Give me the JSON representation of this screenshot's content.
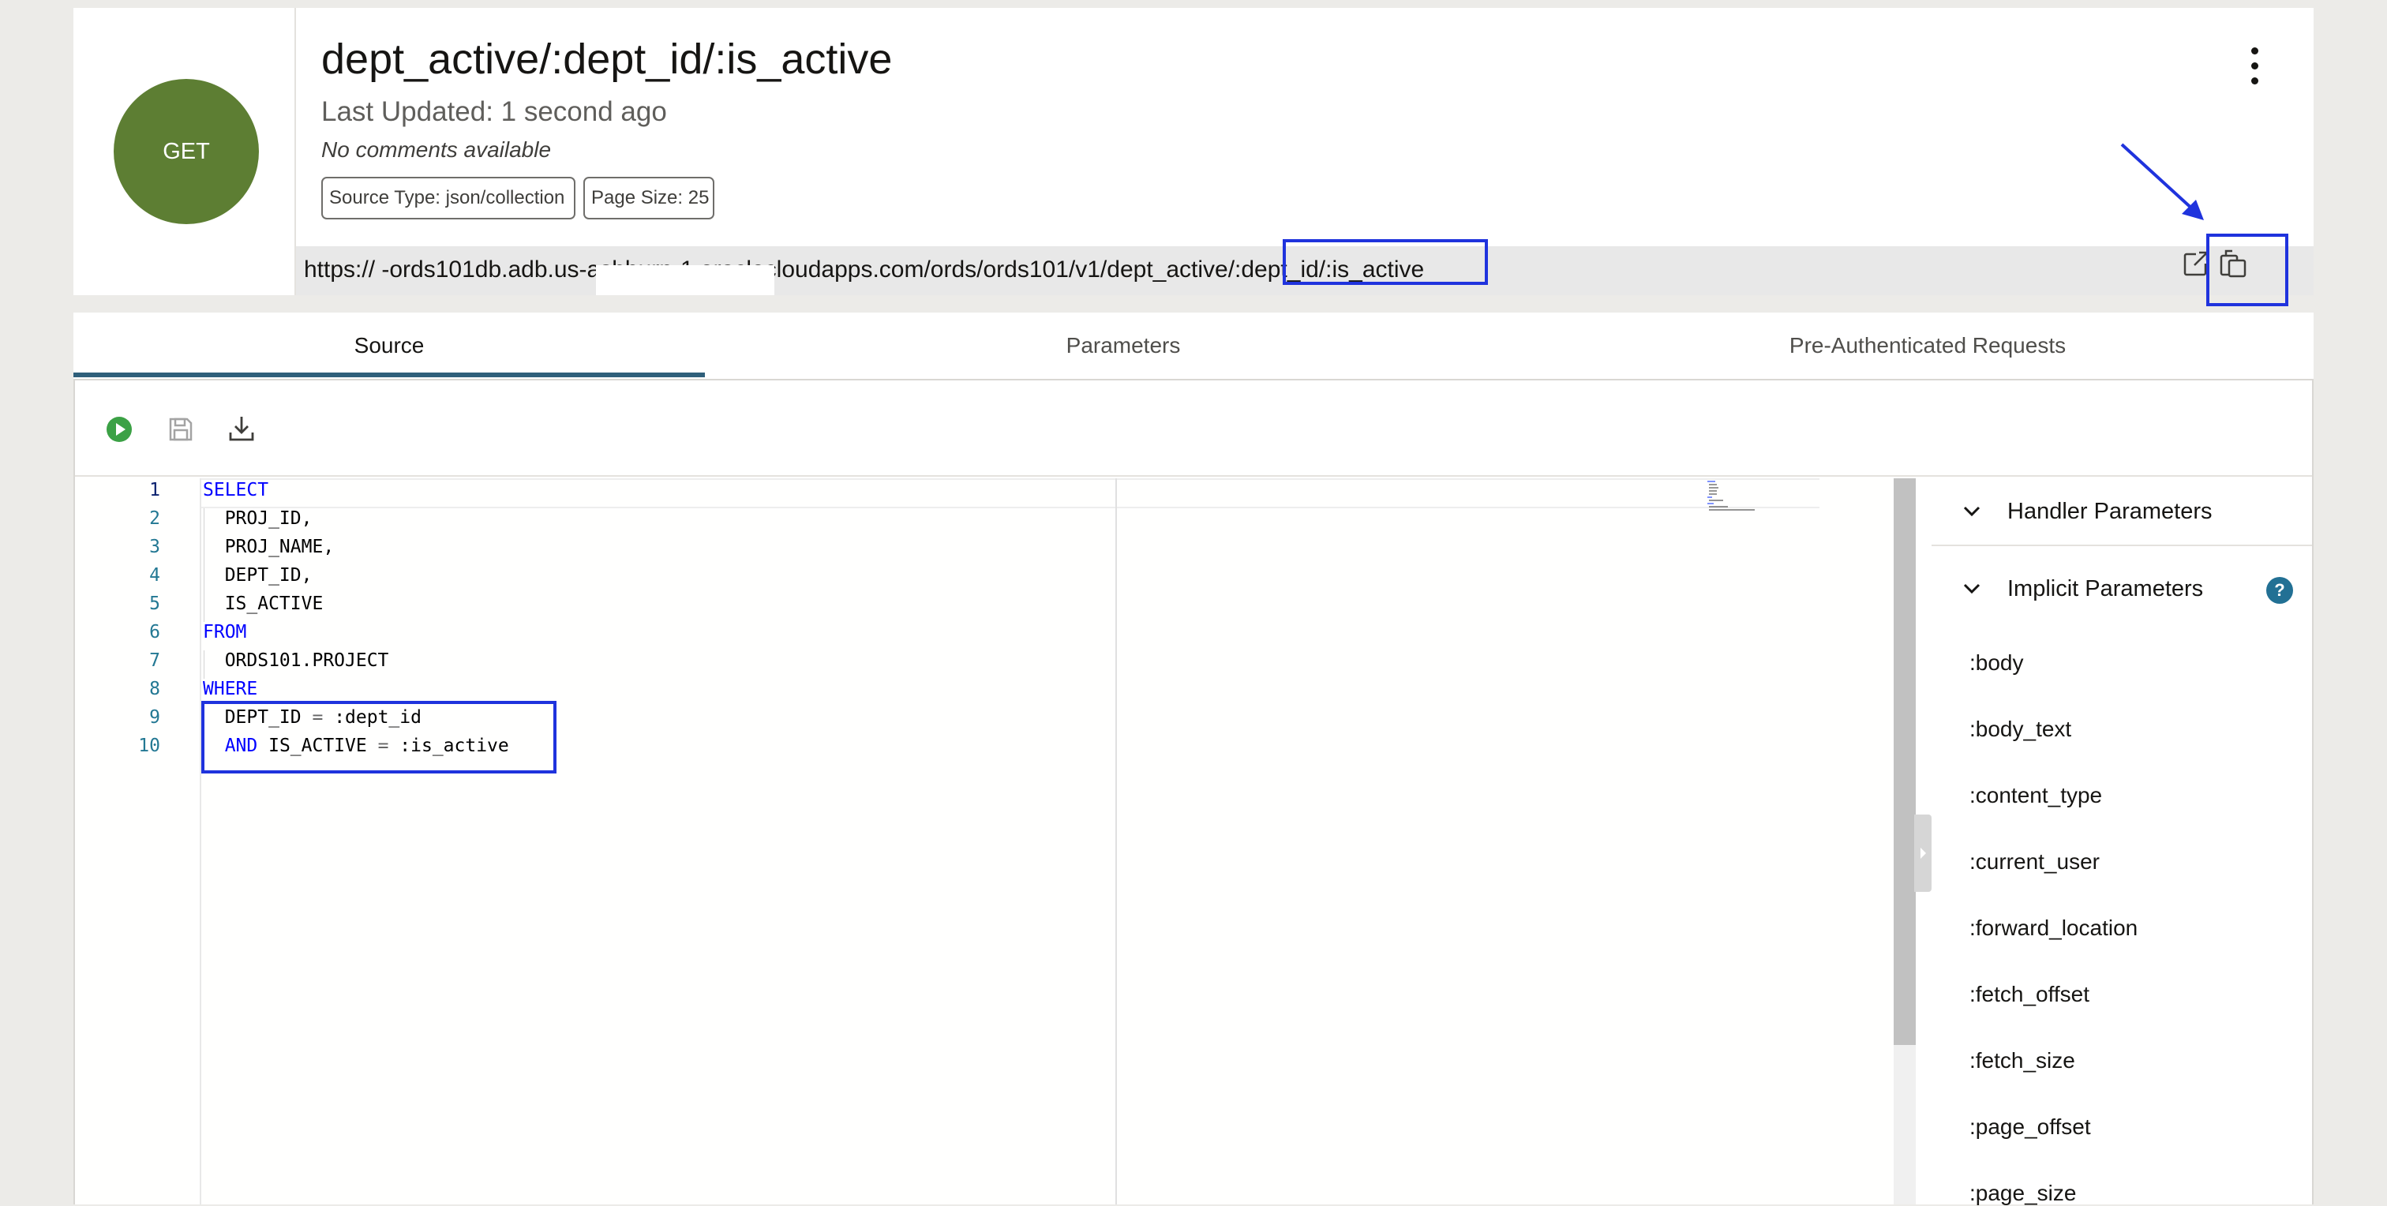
{
  "handler": {
    "method": "GET",
    "title": "dept_active/:dept_id/:is_active",
    "last_updated": "Last Updated: 1 second ago",
    "comments": "No comments available",
    "source_type": "Source Type: json/collection",
    "page_size": "Page Size: 25",
    "url": "https://                              -ords101db.adb.us-ashburn-1.oraclecloudapps.com/ords/ords101/v1/dept_active/:dept_id/:is_active"
  },
  "tabs": [
    {
      "label": "Source",
      "active": true
    },
    {
      "label": "Parameters",
      "active": false
    },
    {
      "label": "Pre-Authenticated Requests",
      "active": false
    }
  ],
  "editor": {
    "line_numbers": [
      "1",
      "2",
      "3",
      "4",
      "5",
      "6",
      "7",
      "8",
      "9",
      "10"
    ],
    "lines": [
      "SELECT",
      "  PROJ_ID,",
      "  PROJ_NAME,",
      "  DEPT_ID,",
      "  IS_ACTIVE",
      "FROM",
      "  ORDS101.PROJECT",
      "WHERE",
      "  DEPT_ID = :dept_id",
      "  AND IS_ACTIVE = :is_active"
    ],
    "code_parts": {
      "select": "SELECT",
      "proj_id": "  PROJ_ID,",
      "proj_name": "  PROJ_NAME,",
      "dept_id": "  DEPT_ID,",
      "is_active": "  IS_ACTIVE",
      "from": "FROM",
      "table": "  ORDS101.PROJECT",
      "where": "WHERE",
      "l9_a": "  DEPT_ID ",
      "l9_op": "=",
      "l9_b": " :dept_id",
      "l10_ws": "  ",
      "l10_kw": "AND",
      "l10_a": " IS_ACTIVE ",
      "l10_op": "=",
      "l10_b": " :is_active"
    }
  },
  "params_panel": {
    "handler_section": "Handler Parameters",
    "implicit_section": "Implicit Parameters",
    "help": "?",
    "implicit_params": [
      ":body",
      ":body_text",
      ":content_type",
      ":current_user",
      ":forward_location",
      ":fetch_offset",
      ":fetch_size",
      ":page_offset",
      ":page_size"
    ]
  },
  "colors": {
    "method_badge": "#5d7e33",
    "annotation": "#1f33dd",
    "tab_underline": "#2f5f7a",
    "keyword": "#0000ff",
    "help_icon": "#227094"
  },
  "icons": [
    "more-vertical-icon",
    "open-external-icon",
    "copy-icon",
    "run-icon",
    "save-icon",
    "download-icon",
    "chevron-down-icon",
    "help-icon",
    "arrow-annotation"
  ]
}
